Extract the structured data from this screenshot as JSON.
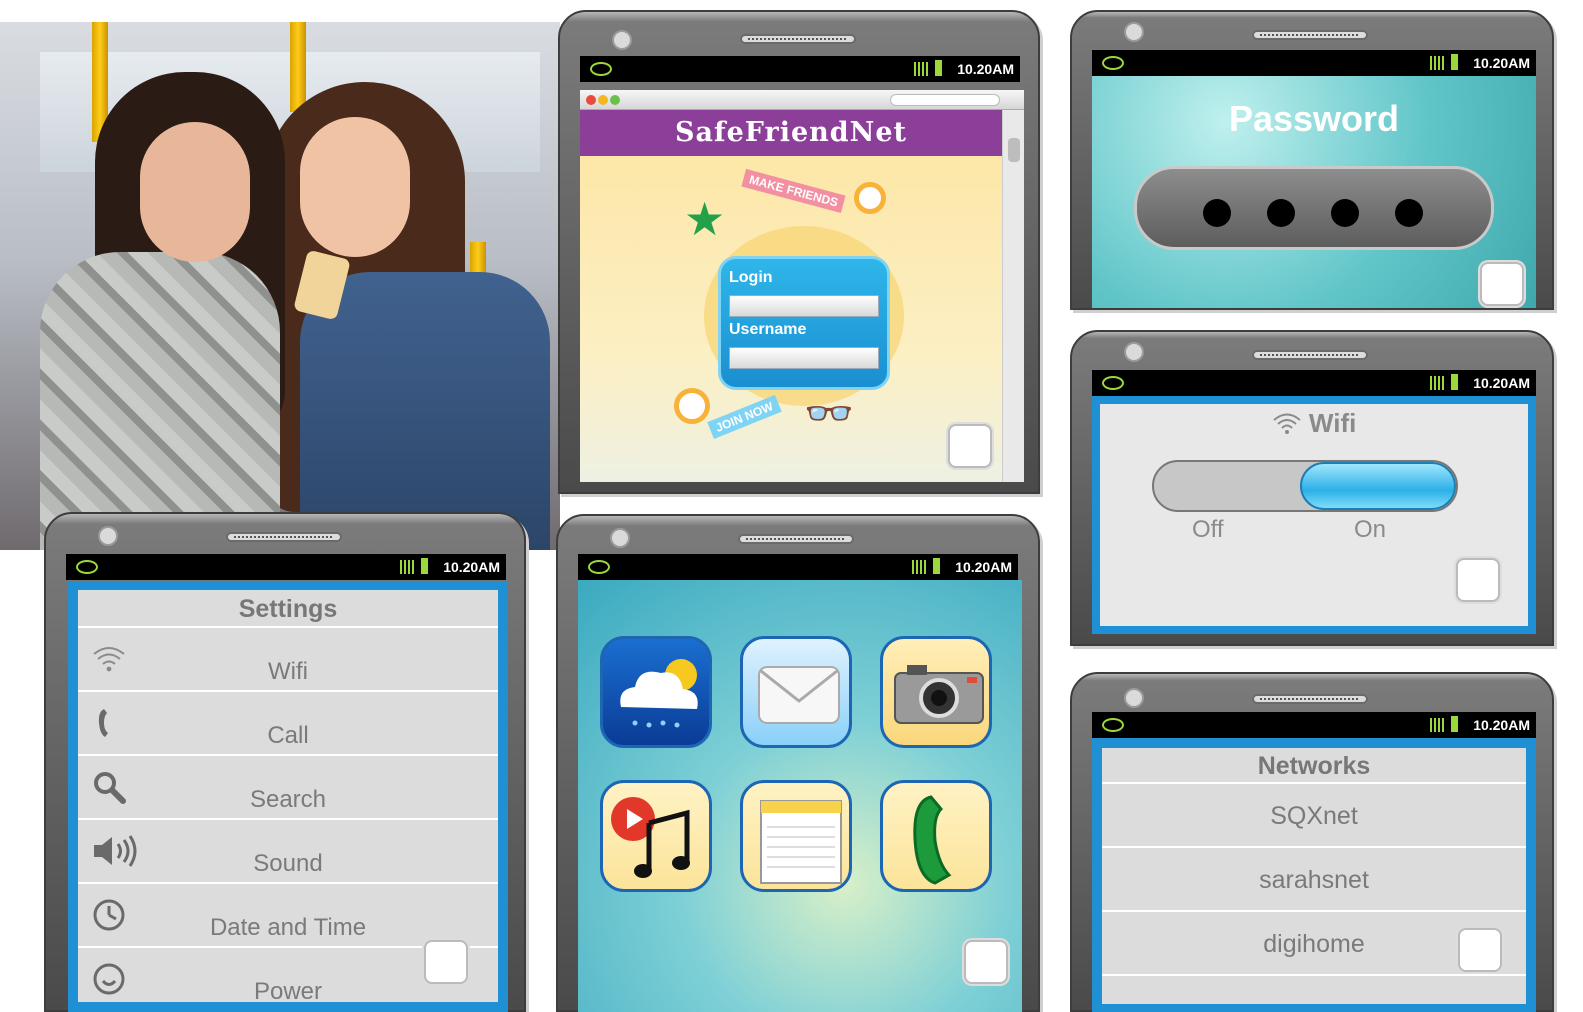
{
  "status_time": "10.20AM",
  "photo": {
    "icon": "photo-two-girls-with-phone"
  },
  "browser": {
    "site_title": "SafeFriendNet",
    "sticker_make_friends": "MAKE FRIENDS",
    "login_label": "Login",
    "username_label": "Username",
    "sticker_join_now": "JOIN NOW"
  },
  "password": {
    "title": "Password",
    "dots": [
      "●",
      "●",
      "●",
      "●"
    ]
  },
  "wifi": {
    "title": "Wifi",
    "off_label": "Off",
    "on_label": "On",
    "state": "on"
  },
  "settings": {
    "title": "Settings",
    "items": [
      {
        "label": "Wifi",
        "icon": "wifi-icon"
      },
      {
        "label": "Call",
        "icon": "phone-handset-icon"
      },
      {
        "label": "Search",
        "icon": "magnifier-icon"
      },
      {
        "label": "Sound",
        "icon": "speaker-icon"
      },
      {
        "label": "Date and Time",
        "icon": "clock-icon"
      },
      {
        "label": "Power",
        "icon": "power-icon"
      }
    ]
  },
  "home": {
    "apps": [
      {
        "name": "weather",
        "icon": "weather-icon"
      },
      {
        "name": "mail",
        "icon": "mail-icon"
      },
      {
        "name": "camera",
        "icon": "camera-icon"
      },
      {
        "name": "music",
        "icon": "music-icon"
      },
      {
        "name": "notes",
        "icon": "notepad-icon"
      },
      {
        "name": "phone",
        "icon": "phone-icon"
      }
    ]
  },
  "networks": {
    "title": "Networks",
    "items": [
      "SQXnet",
      "sarahsnet",
      "digihome"
    ]
  },
  "colors": {
    "screen_blue": "#1f90d4",
    "title_purple": "#8c3f98",
    "status_green": "#9bd93a"
  }
}
